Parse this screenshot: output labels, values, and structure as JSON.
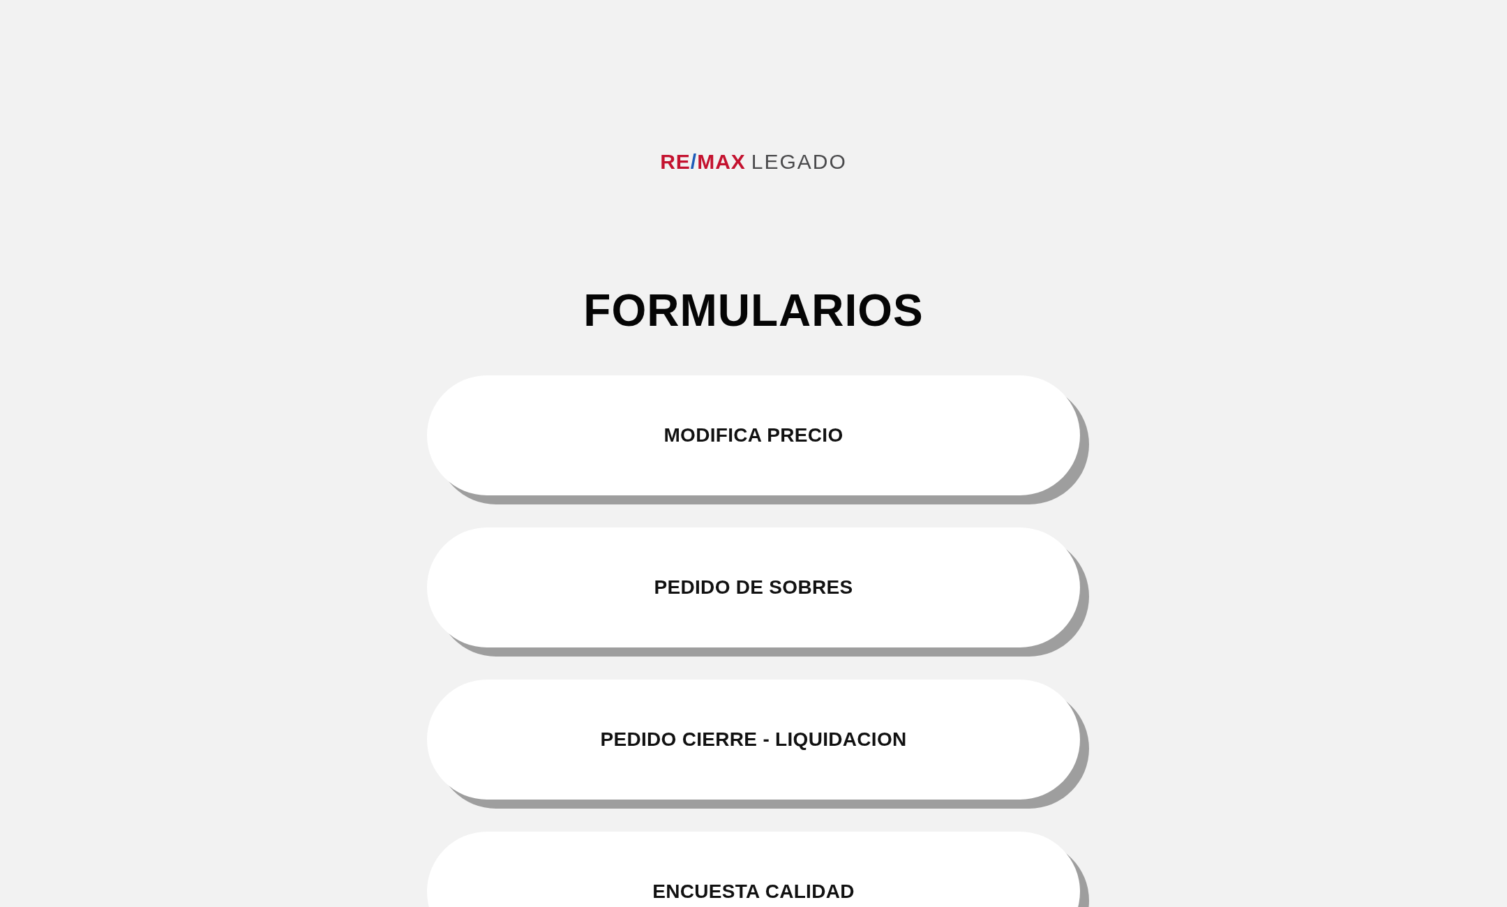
{
  "logo": {
    "brand_parts": [
      "RE",
      "/",
      "MAX"
    ],
    "name": "LEGADO"
  },
  "title": "FORMULARIOS",
  "form_buttons": [
    {
      "label": "MODIFICA PRECIO"
    },
    {
      "label": "PEDIDO DE SOBRES"
    },
    {
      "label": "PEDIDO CIERRE - LIQUIDACION"
    },
    {
      "label": "ENCUESTA CALIDAD"
    }
  ]
}
